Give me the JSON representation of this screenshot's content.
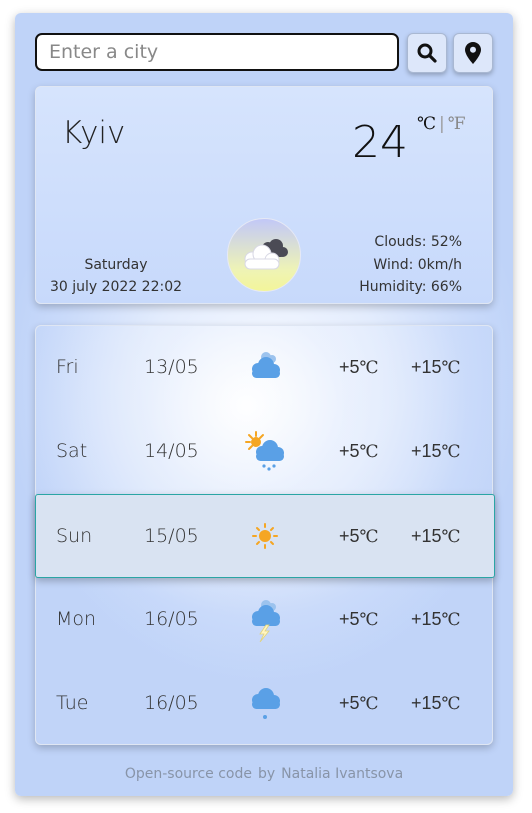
{
  "search": {
    "placeholder": "Enter a city",
    "value": ""
  },
  "buttons": {
    "search_icon": "search-icon",
    "location_icon": "location-pin-icon"
  },
  "current": {
    "city": "Kyiv",
    "temperature": "24",
    "unit_c": "℃",
    "unit_sep": "|",
    "unit_f": "℉",
    "day": "Saturday",
    "datetime": "30 july 2022 22:02",
    "icon": "cloudy-night-icon",
    "clouds": "Clouds: 52%",
    "wind": "Wind: 0km/h",
    "humidity": "Humidity: 66%"
  },
  "forecast": [
    {
      "day": "Fri",
      "date": "13/05",
      "icon": "cloudy-icon",
      "min": "+5",
      "max": "+15",
      "deg": "℃"
    },
    {
      "day": "Sat",
      "date": "14/05",
      "icon": "sun-rain-icon",
      "min": "+5",
      "max": "+15",
      "deg": "℃"
    },
    {
      "day": "Sun",
      "date": "15/05",
      "icon": "sun-icon",
      "min": "+5",
      "max": "+15",
      "deg": "℃"
    },
    {
      "day": "Mon",
      "date": "16/05",
      "icon": "thunderstorm-icon",
      "min": "+5",
      "max": "+15",
      "deg": "℃"
    },
    {
      "day": "Tue",
      "date": "16/05",
      "icon": "drizzle-icon",
      "min": "+5",
      "max": "+15",
      "deg": "℃"
    }
  ],
  "footer": {
    "link_text": "Open-source code",
    "by": "by",
    "author": "Natalia Ivantsova"
  },
  "colors": {
    "accent": "#2aa5a5",
    "cloud": "#5aa0e6",
    "sun": "#f5a623"
  }
}
